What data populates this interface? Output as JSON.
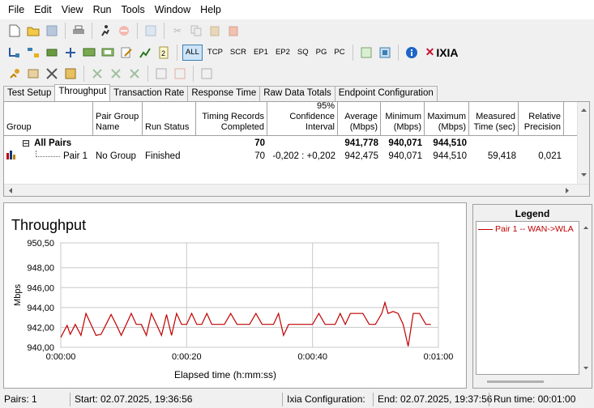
{
  "menu": [
    "File",
    "Edit",
    "View",
    "Run",
    "Tools",
    "Window",
    "Help"
  ],
  "toolbar": {
    "protocols": [
      "ALL",
      "TCP",
      "SCR",
      "EP1",
      "EP2",
      "SQ",
      "PG",
      "PC"
    ],
    "brand": "IXIA"
  },
  "tabs": [
    "Test Setup",
    "Throughput",
    "Transaction Rate",
    "Response Time",
    "Raw Data Totals",
    "Endpoint Configuration"
  ],
  "grid": {
    "headers": {
      "group": "Group",
      "pair_group_name": "Pair Group Name",
      "run_status": "Run Status",
      "timing_records": "Timing Records Completed",
      "confidence": "95% Confidence Interval",
      "average": "Average (Mbps)",
      "minimum": "Minimum (Mbps)",
      "maximum": "Maximum (Mbps)",
      "measured_time": "Measured Time (sec)",
      "relative_precision": "Relative Precision"
    },
    "all_pairs": {
      "expander": "⊟",
      "group": "All Pairs",
      "timing_records": "70",
      "average": "941,778",
      "minimum": "940,071",
      "maximum": "944,510"
    },
    "pair1": {
      "group": "Pair 1",
      "pair_group_name": "No Group",
      "run_status": "Finished",
      "timing_records": "70",
      "confidence": "-0,202 : +0,202",
      "average": "942,475",
      "minimum": "940,071",
      "maximum": "944,510",
      "measured_time": "59,418",
      "relative_precision": "0,021"
    }
  },
  "chart_data": {
    "type": "line",
    "title": "Throughput",
    "xlabel": "Elapsed time (h:mm:ss)",
    "ylabel": "Mbps",
    "ylim": [
      940.0,
      950.5
    ],
    "xlim": [
      0,
      60
    ],
    "yticks": [
      "950,50",
      "948,00",
      "946,00",
      "944,00",
      "942,00",
      "940,00"
    ],
    "ytick_values": [
      950.5,
      948.0,
      946.0,
      944.0,
      942.0,
      940.0
    ],
    "xticks": [
      "0:00:00",
      "0:00:20",
      "0:00:40",
      "0:01:00"
    ],
    "xtick_values": [
      0,
      20,
      40,
      60
    ],
    "grid": true,
    "color": "#c00000",
    "series": [
      {
        "name": "Pair 1 -- WAN->WLA",
        "x": [
          0,
          1,
          1.5,
          2.3,
          3.2,
          4.0,
          4.8,
          5.6,
          6.4,
          7.2,
          8.0,
          8.8,
          9.6,
          10.4,
          11.2,
          12.0,
          12.8,
          13.6,
          14.4,
          15.2,
          16.0,
          16.8,
          17.6,
          18.4,
          19.2,
          20.0,
          20.8,
          21.6,
          22.4,
          23.2,
          24.0,
          25.0,
          26.0,
          27.0,
          28.0,
          29.0,
          30.0,
          31.0,
          32.0,
          33.0,
          33.8,
          34.6,
          35.4,
          36.2,
          37.0,
          38.0,
          39.0,
          40.0,
          41.0,
          42.0,
          42.8,
          43.6,
          44.4,
          45.2,
          46.0,
          47.0,
          48.0,
          49.0,
          50.0,
          51.0,
          51.5,
          52.0,
          52.8,
          53.6,
          54.4,
          55.2,
          56.0,
          57.0,
          58.0,
          58.8
        ],
        "y": [
          941.0,
          942.2,
          941.3,
          942.3,
          941.2,
          943.4,
          942.3,
          941.2,
          941.3,
          942.3,
          943.3,
          942.3,
          941.2,
          942.3,
          943.4,
          942.3,
          942.3,
          941.2,
          943.4,
          942.3,
          941.2,
          943.3,
          941.2,
          943.4,
          942.3,
          942.3,
          943.4,
          942.3,
          942.3,
          943.4,
          942.3,
          942.3,
          942.3,
          943.4,
          942.3,
          942.3,
          942.3,
          943.4,
          942.3,
          942.3,
          942.3,
          943.4,
          941.2,
          942.3,
          942.3,
          942.3,
          942.3,
          942.3,
          943.4,
          942.3,
          942.3,
          942.3,
          943.4,
          942.3,
          943.4,
          943.4,
          943.4,
          942.3,
          942.3,
          943.4,
          944.5,
          943.4,
          943.6,
          943.4,
          942.3,
          940.1,
          943.4,
          943.4,
          942.3,
          942.3
        ]
      }
    ]
  },
  "legend": {
    "title": "Legend",
    "item": "Pair 1 -- WAN->WLA"
  },
  "status": {
    "pairs": "Pairs: 1",
    "start": "Start: 02.07.2025, 19:36:56",
    "ixia_config": "Ixia Configuration:",
    "end": "End: 02.07.2025, 19:37:56",
    "run_time": "Run time: 00:01:00"
  }
}
